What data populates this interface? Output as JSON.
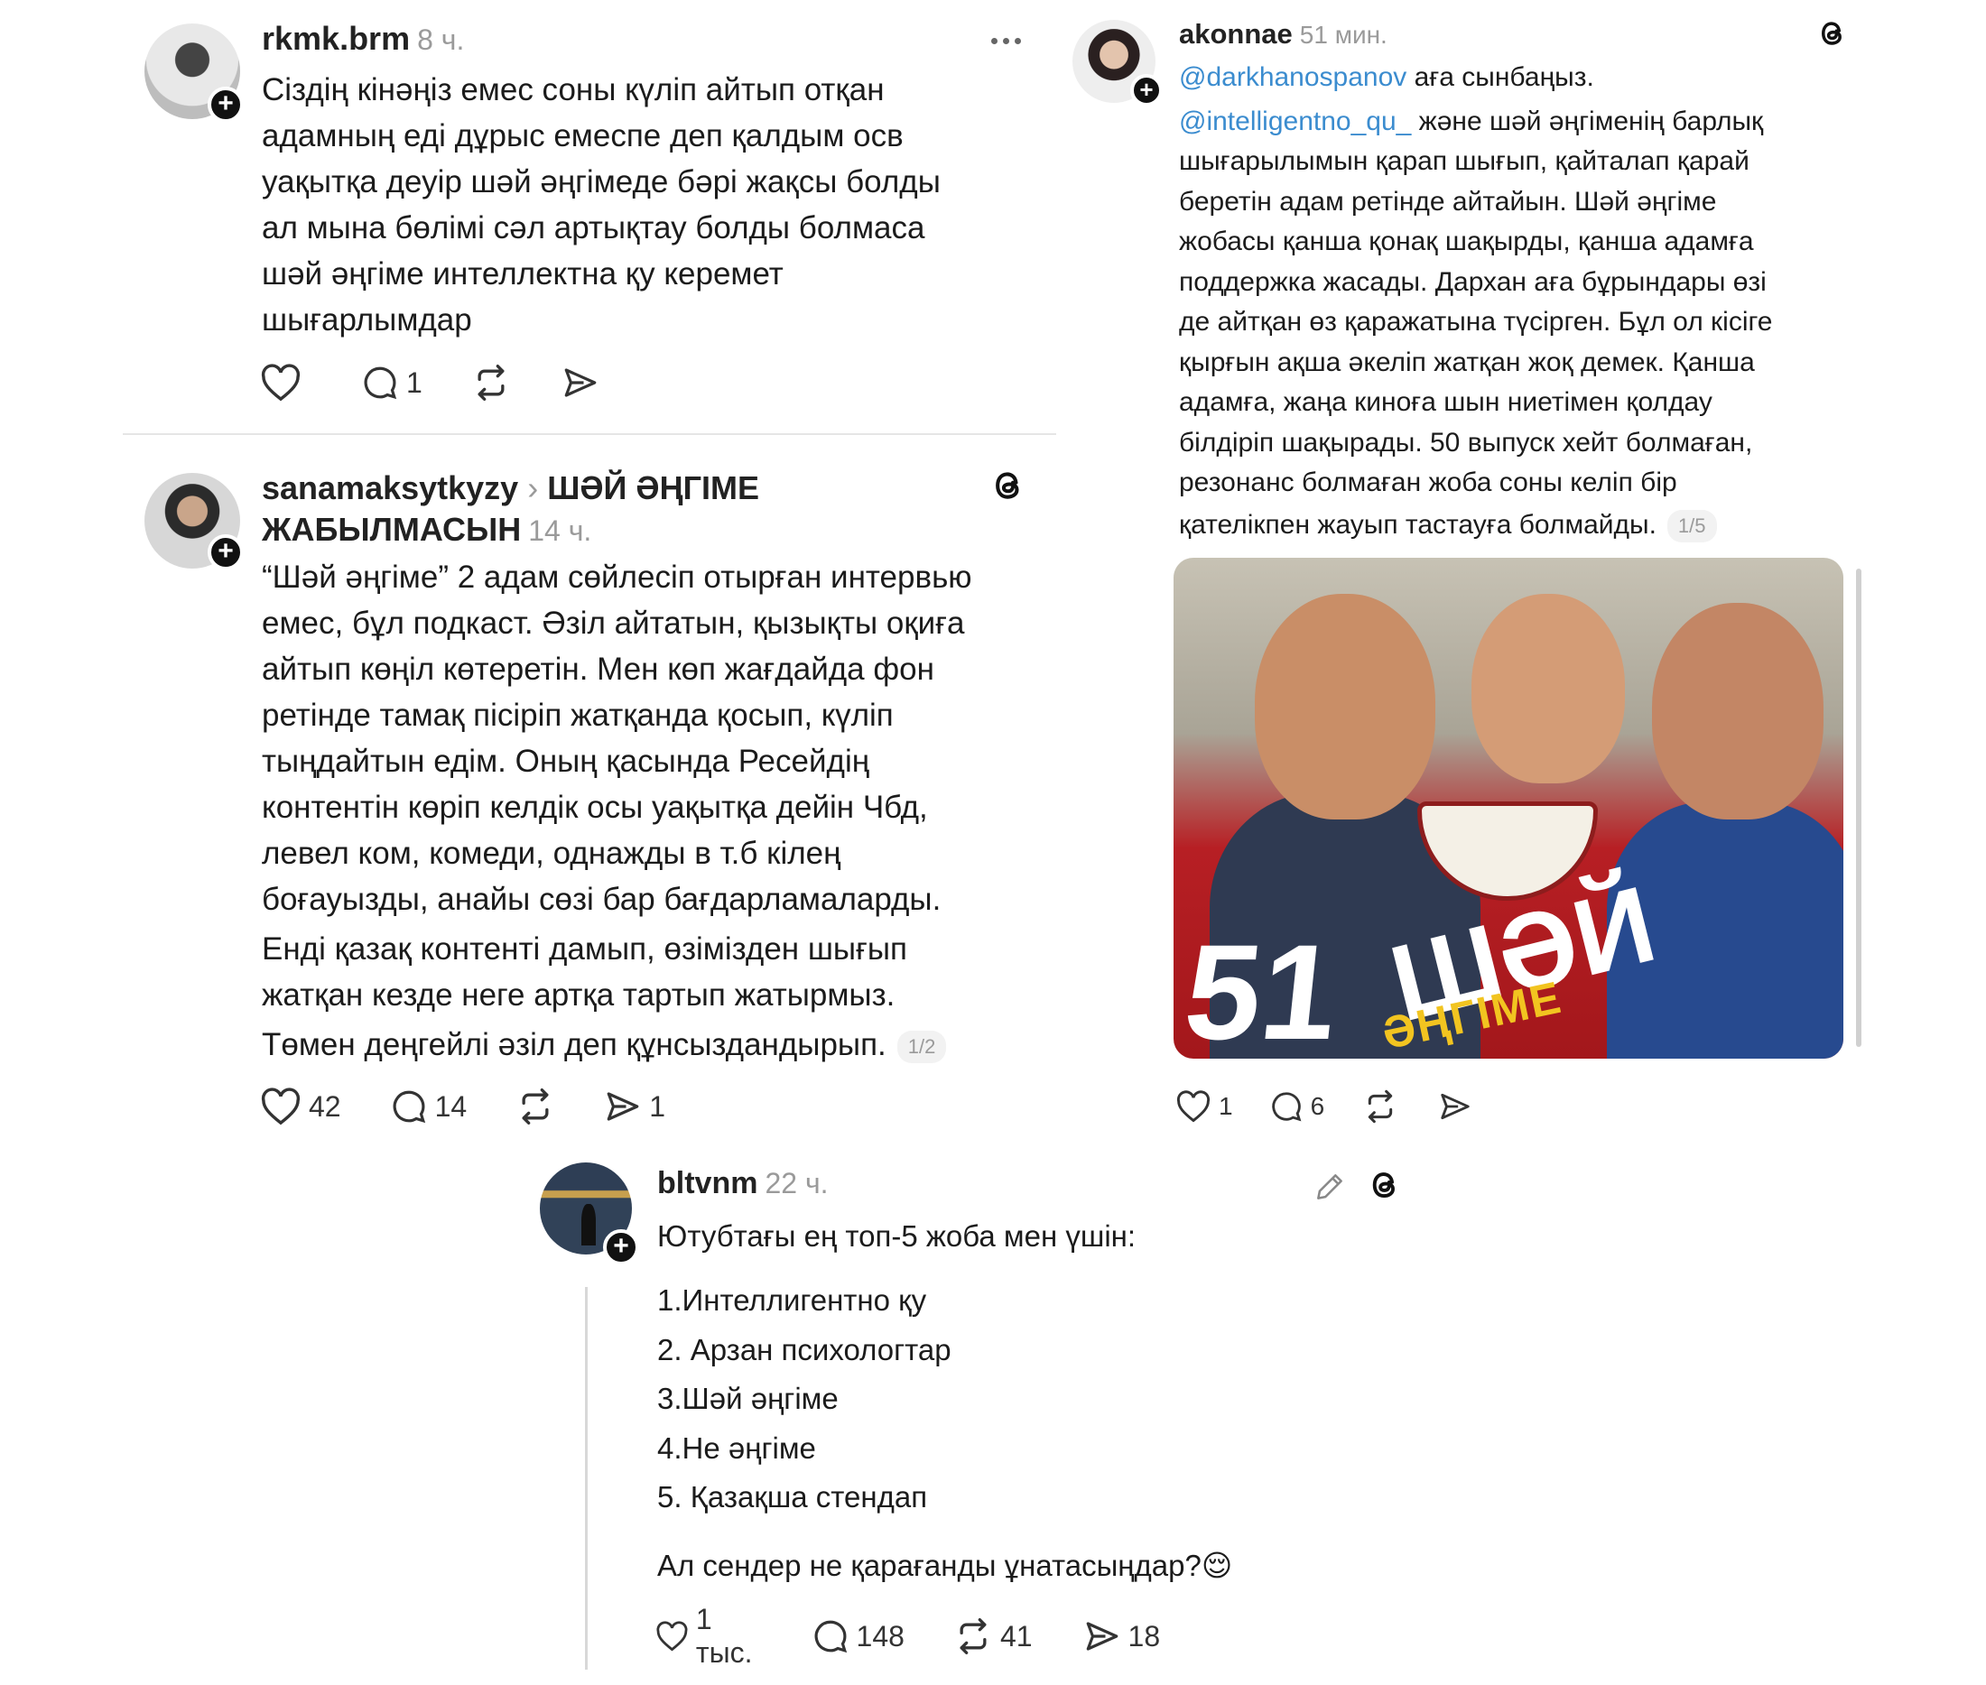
{
  "posts": [
    {
      "username": "rkmk.brm",
      "time": "8 ч.",
      "lines": [
        "Сіздің кінәңіз емес соны күліп айтып отқан",
        "адамның еді дұрыс емеспе деп қалдым осв",
        "уақытқа деуір шәй әңгімеде бәрі жақсы болды",
        "ал мына бөлімі сәл артықтау болды болмаса",
        "шәй әңгіме интеллектна қу керемет",
        "шығарлымдар"
      ],
      "replies": "1"
    },
    {
      "username": "sanamaksytkyzy",
      "topic_line1": "ШӘЙ ӘҢГІМЕ",
      "topic_line2": "ЖАБЫЛМАСЫН",
      "time": "14 ч.",
      "lines": [
        "“Шәй әңгіме” 2 адам сөйлесіп отырған интервью",
        "емес, бұл подкаст. Әзіл айтатын, қызықты оқиға",
        "айтып көңіл көтеретін. Мен көп жағдайда фон",
        "ретінде тамақ пісіріп жатқанда қосып, күліп",
        "тыңдайтын едім.  Оның қасында Ресейдің",
        "контентін көріп келдік осы уақытқа дейін Чбд,",
        "левел ком, комеди, однажды в т.б кілең",
        "боғауызды, анайы сөзі бар бағдарламаларды.",
        "Енді қазақ контенті дамып, өзімізден шығып",
        "жатқан кезде неге артқа тартып жатырмыз.",
        "Төмен деңгейлі әзіл деп құнсыздандырып."
      ],
      "pager": "1/2",
      "likes": "42",
      "replies": "14",
      "shares": "1"
    },
    {
      "username": "akonnae",
      "time": "51 мин.",
      "mention1": "@darkhanospanov",
      "line1_rest": " аға сынбаңыз.",
      "mention2": "@intelligentno_qu_",
      "line2_rest": " және шәй әңгіменің барлық",
      "lines": [
        "шығарылымын қарап шығып, қайталап қарай",
        "беретін адам ретінде айтайын. Шәй әңгіме",
        "жобасы қанша қонақ шақырды, қанша адамға",
        "поддержка жасады. Дархан аға бұрындары өзі",
        "де айтқан өз қаражатына түсірген. Бұл ол кісіге",
        "қырғын ақша әкеліп жатқан жоқ демек. Қанша",
        "адамға, жаңа киноға шын ниетімен қолдау",
        "білдіріп шақырады. 50 выпуск хейт болмаған,",
        "резонанс болмаған жоба соны келіп бір",
        "қателікпен жауып тастауға болмайды."
      ],
      "pager": "1/5",
      "thumb_number": "51",
      "thumb_title": "ШӘЙ",
      "thumb_subtitle": "ӘҢГІМЕ",
      "likes": "1",
      "replies": "6"
    },
    {
      "username": "bltvnm",
      "time": "22 ч.",
      "intro": "Ютубтағы ең топ-5 жоба мен үшін:",
      "list": [
        "1.Интеллигентно қу",
        "2. Арзан психологтар",
        "3.Шәй әңгіме",
        "4.Не әңгіме",
        "5. Қазақша стендап"
      ],
      "question": "Ал сендер не қарағанды ұнатасыңдар?",
      "emoji": "😌",
      "likes": "1 тыс.",
      "replies": "148",
      "reposts": "41",
      "shares": "18"
    }
  ],
  "colors": {
    "mention": "#3b8ccf",
    "muted": "#9a9a9a",
    "text": "#1b1b1b"
  },
  "icons": [
    "heart-icon",
    "comment-icon",
    "repost-icon",
    "share-icon",
    "threads-icon",
    "more-icon",
    "pencil-icon",
    "follow-plus-icon"
  ]
}
